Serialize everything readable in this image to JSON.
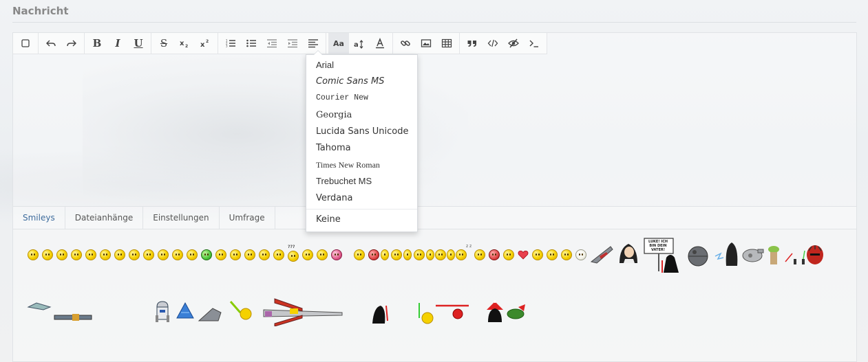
{
  "section": {
    "title": "Nachricht"
  },
  "toolbar": {
    "font_label": "Aa",
    "buttons": [
      "checkbox",
      "undo",
      "redo",
      "bold",
      "italic",
      "underline",
      "strikethrough",
      "subscript",
      "superscript",
      "ordered-list",
      "unordered-list",
      "outdent",
      "indent",
      "align",
      "font",
      "font-size",
      "font-color",
      "link",
      "image",
      "table",
      "quote",
      "code",
      "spoiler",
      "terminal"
    ]
  },
  "font_menu": {
    "items": [
      {
        "label": "Arial"
      },
      {
        "label": "Comic Sans MS"
      },
      {
        "label": "Courier New"
      },
      {
        "label": "Georgia"
      },
      {
        "label": "Lucida Sans Unicode"
      },
      {
        "label": "Tahoma"
      },
      {
        "label": "Times New Roman"
      },
      {
        "label": "Trebuchet MS"
      },
      {
        "label": "Verdana"
      }
    ],
    "none_label": "Keine"
  },
  "tabs": [
    {
      "label": "Smileys",
      "active": true
    },
    {
      "label": "Dateianhänge",
      "active": false
    },
    {
      "label": "Einstellungen",
      "active": false
    },
    {
      "label": "Umfrage",
      "active": false
    }
  ],
  "smileys": {
    "sign_text": "LUKE! ICH BIN DEIN VATER!",
    "sleep_text": "z z",
    "question_text": "???"
  },
  "colors": {
    "tab_active": "#3d6b9c",
    "title": "#888888"
  }
}
